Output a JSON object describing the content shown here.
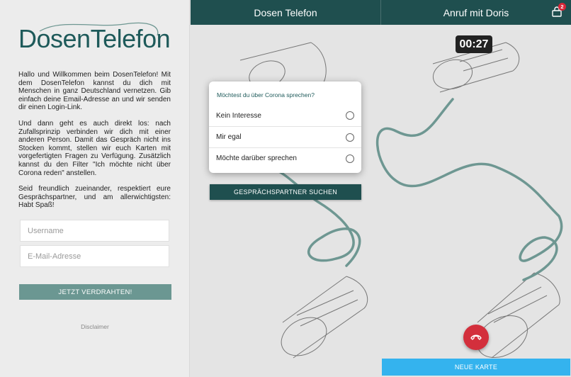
{
  "brand": {
    "logo_text": "DosenTelefon",
    "color": "#1e5a5a"
  },
  "intro": {
    "p1": "Hallo und Willkommen beim DosenTelefon! Mit dem DosenTelefon kannst du dich mit Menschen in ganz Deutschland vernetzen. Gib einfach deine Email-Adresse an und wir senden dir einen Login-Link.",
    "p2": "Und dann geht es auch direkt los: nach Zufallsprinzip verbinden wir dich mit einer anderen Person. Damit das Gespräch nicht ins Stocken kommt, stellen wir euch Karten mit vorgefertigten Fragen zu Verfügung. Zusätzlich kannst du den Filter \"Ich möchte nicht über Corona reden\" anstellen.",
    "p3": "Seid freundlich zueinander, respektiert eure Gesprächspartner, und am allerwichtigsten: Habt Spaß!"
  },
  "form": {
    "username_placeholder": "Username",
    "username_value": "",
    "email_placeholder": "E-Mail-Adresse",
    "email_value": "",
    "submit_label": "JETZT VERDRAHTEN!"
  },
  "disclaimer": "Disclaimer",
  "header": {
    "left_title": "Dosen Telefon",
    "right_title": "Anruf mit Doris",
    "badge_count": "2"
  },
  "card": {
    "question": "Möchtest du über Corona sprechen?",
    "options": [
      "Kein Interesse",
      "Mir egal",
      "Möchte darüber sprechen"
    ]
  },
  "search_button": "GESPRÄCHSPARTNER SUCHEN",
  "timer": "00:27",
  "new_card_button": "NEUE KARTE",
  "colors": {
    "header_bg": "#1f4f4f",
    "accent": "#6b9792",
    "string": "#6e9792",
    "hangup": "#d32f3c",
    "new_card": "#34b3ee"
  },
  "icons": {
    "header_icon": "phone-box-icon",
    "hangup_icon": "phone-hangup-icon",
    "radio": "radio-circle-icon"
  }
}
